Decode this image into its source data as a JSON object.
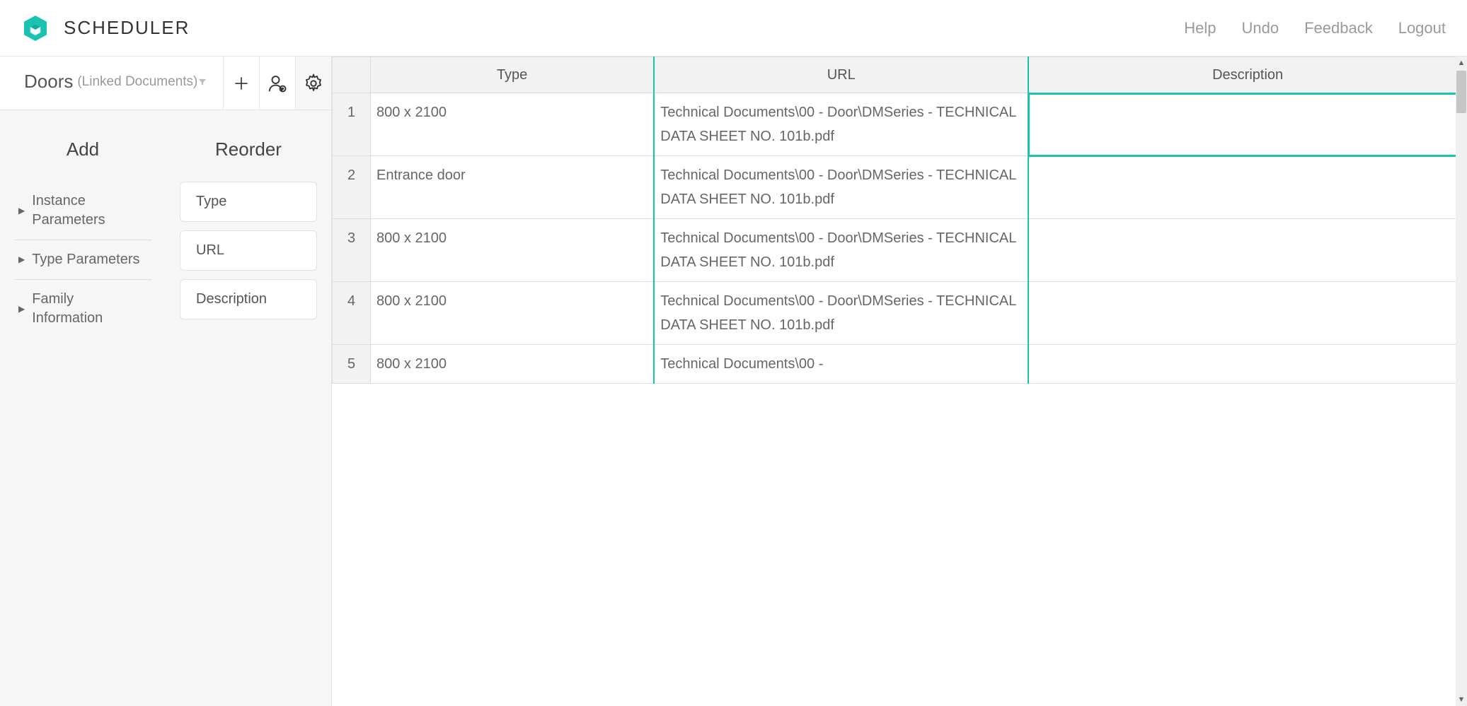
{
  "app": {
    "title": "SCHEDULER"
  },
  "nav": {
    "help": "Help",
    "undo": "Undo",
    "feedback": "Feedback",
    "logout": "Logout"
  },
  "sidebar": {
    "title": "Doors",
    "subtitle": "(Linked Documents)",
    "addHeading": "Add",
    "reorderHeading": "Reorder",
    "tree": {
      "instance": "Instance Parameters",
      "type": "Type Parameters",
      "family": "Family Information"
    },
    "chips": {
      "type": "Type",
      "url": "URL",
      "description": "Description"
    }
  },
  "table": {
    "columns": {
      "type": "Type",
      "url": "URL",
      "description": "Description"
    },
    "rows": [
      {
        "n": "1",
        "type": "800 x 2100",
        "url": "Technical Documents\\00 - Door\\DMSeries - TECHNICAL DATA SHEET NO. 101b.pdf",
        "desc": ""
      },
      {
        "n": "2",
        "type": "Entrance door",
        "url": "Technical Documents\\00 - Door\\DMSeries - TECHNICAL DATA SHEET NO. 101b.pdf",
        "desc": ""
      },
      {
        "n": "3",
        "type": "800 x 2100",
        "url": "Technical Documents\\00 - Door\\DMSeries - TECHNICAL DATA SHEET NO. 101b.pdf",
        "desc": ""
      },
      {
        "n": "4",
        "type": "800 x 2100",
        "url": "Technical Documents\\00 - Door\\DMSeries - TECHNICAL DATA SHEET NO. 101b.pdf",
        "desc": ""
      },
      {
        "n": "5",
        "type": "800 x 2100",
        "url": "Technical Documents\\00 - ",
        "desc": ""
      }
    ]
  }
}
